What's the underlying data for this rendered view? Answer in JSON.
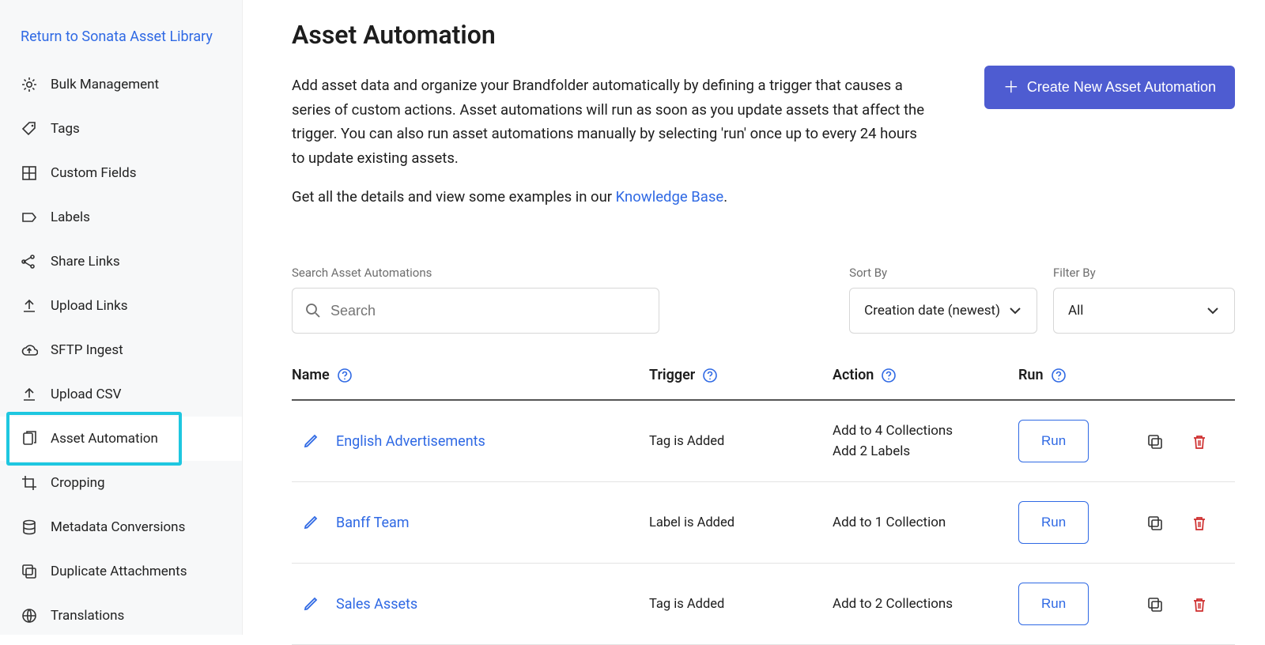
{
  "sidebar": {
    "return_link": "Return to Sonata Asset Library",
    "items": [
      {
        "icon": "gear",
        "label": "Bulk Management"
      },
      {
        "icon": "tag",
        "label": "Tags"
      },
      {
        "icon": "grid",
        "label": "Custom Fields"
      },
      {
        "icon": "label",
        "label": "Labels"
      },
      {
        "icon": "share",
        "label": "Share Links"
      },
      {
        "icon": "upload",
        "label": "Upload Links"
      },
      {
        "icon": "cloud",
        "label": "SFTP Ingest"
      },
      {
        "icon": "upload",
        "label": "Upload CSV"
      },
      {
        "icon": "copy",
        "label": "Asset Automation",
        "active": true
      },
      {
        "icon": "crop",
        "label": "Cropping"
      },
      {
        "icon": "stack",
        "label": "Metadata Conversions"
      },
      {
        "icon": "dup",
        "label": "Duplicate Attachments"
      },
      {
        "icon": "globe",
        "label": "Translations"
      }
    ]
  },
  "header": {
    "title": "Asset Automation",
    "description": "Add asset data and organize your Brandfolder automatically by defining a trigger that causes a series of custom actions. Asset automations will run as soon as you update assets that affect the trigger. You can also run asset automations manually by selecting 'run' once up to every 24 hours to update existing assets.",
    "kb_intro": "Get all the details and view some examples in our ",
    "kb_link": "Knowledge Base",
    "kb_suffix": ".",
    "create_button": "Create New Asset Automation"
  },
  "controls": {
    "search_label": "Search Asset Automations",
    "search_placeholder": "Search",
    "sort_label": "Sort By",
    "sort_value": "Creation date (newest)",
    "filter_label": "Filter By",
    "filter_value": "All"
  },
  "table": {
    "columns": {
      "name": "Name",
      "trigger": "Trigger",
      "action": "Action",
      "run": "Run"
    },
    "run_button": "Run",
    "rows": [
      {
        "name": "English Advertisements",
        "trigger": "Tag is Added",
        "actions": [
          "Add to 4 Collections",
          "Add 2 Labels"
        ]
      },
      {
        "name": "Banff Team",
        "trigger": "Label is Added",
        "actions": [
          "Add to 1 Collection"
        ]
      },
      {
        "name": "Sales Assets",
        "trigger": "Tag is Added",
        "actions": [
          "Add to 2 Collections"
        ]
      }
    ]
  }
}
